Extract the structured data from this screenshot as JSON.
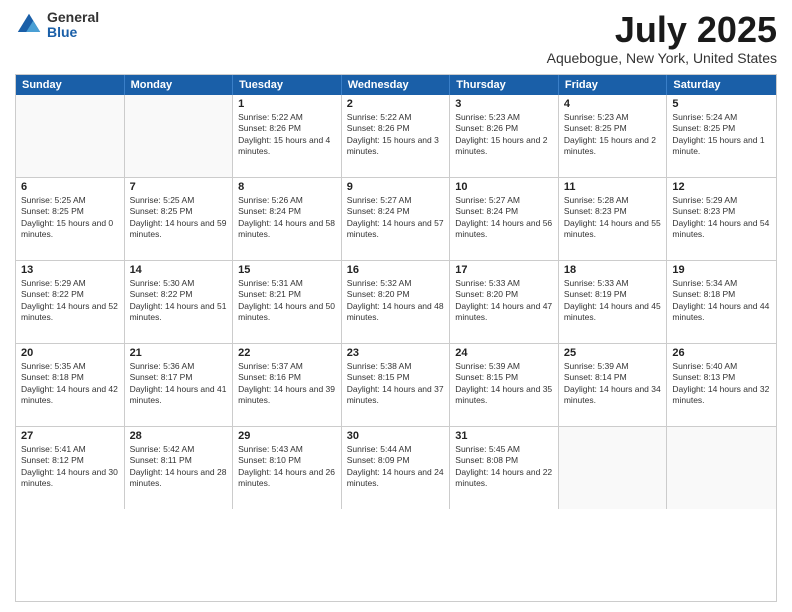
{
  "logo": {
    "general": "General",
    "blue": "Blue"
  },
  "header": {
    "title": "July 2025",
    "subtitle": "Aquebogue, New York, United States"
  },
  "days_of_week": [
    "Sunday",
    "Monday",
    "Tuesday",
    "Wednesday",
    "Thursday",
    "Friday",
    "Saturday"
  ],
  "weeks": [
    [
      {
        "day": "",
        "empty": true
      },
      {
        "day": "",
        "empty": true
      },
      {
        "day": "1",
        "sunrise": "Sunrise: 5:22 AM",
        "sunset": "Sunset: 8:26 PM",
        "daylight": "Daylight: 15 hours and 4 minutes."
      },
      {
        "day": "2",
        "sunrise": "Sunrise: 5:22 AM",
        "sunset": "Sunset: 8:26 PM",
        "daylight": "Daylight: 15 hours and 3 minutes."
      },
      {
        "day": "3",
        "sunrise": "Sunrise: 5:23 AM",
        "sunset": "Sunset: 8:26 PM",
        "daylight": "Daylight: 15 hours and 2 minutes."
      },
      {
        "day": "4",
        "sunrise": "Sunrise: 5:23 AM",
        "sunset": "Sunset: 8:25 PM",
        "daylight": "Daylight: 15 hours and 2 minutes."
      },
      {
        "day": "5",
        "sunrise": "Sunrise: 5:24 AM",
        "sunset": "Sunset: 8:25 PM",
        "daylight": "Daylight: 15 hours and 1 minute."
      }
    ],
    [
      {
        "day": "6",
        "sunrise": "Sunrise: 5:25 AM",
        "sunset": "Sunset: 8:25 PM",
        "daylight": "Daylight: 15 hours and 0 minutes."
      },
      {
        "day": "7",
        "sunrise": "Sunrise: 5:25 AM",
        "sunset": "Sunset: 8:25 PM",
        "daylight": "Daylight: 14 hours and 59 minutes."
      },
      {
        "day": "8",
        "sunrise": "Sunrise: 5:26 AM",
        "sunset": "Sunset: 8:24 PM",
        "daylight": "Daylight: 14 hours and 58 minutes."
      },
      {
        "day": "9",
        "sunrise": "Sunrise: 5:27 AM",
        "sunset": "Sunset: 8:24 PM",
        "daylight": "Daylight: 14 hours and 57 minutes."
      },
      {
        "day": "10",
        "sunrise": "Sunrise: 5:27 AM",
        "sunset": "Sunset: 8:24 PM",
        "daylight": "Daylight: 14 hours and 56 minutes."
      },
      {
        "day": "11",
        "sunrise": "Sunrise: 5:28 AM",
        "sunset": "Sunset: 8:23 PM",
        "daylight": "Daylight: 14 hours and 55 minutes."
      },
      {
        "day": "12",
        "sunrise": "Sunrise: 5:29 AM",
        "sunset": "Sunset: 8:23 PM",
        "daylight": "Daylight: 14 hours and 54 minutes."
      }
    ],
    [
      {
        "day": "13",
        "sunrise": "Sunrise: 5:29 AM",
        "sunset": "Sunset: 8:22 PM",
        "daylight": "Daylight: 14 hours and 52 minutes."
      },
      {
        "day": "14",
        "sunrise": "Sunrise: 5:30 AM",
        "sunset": "Sunset: 8:22 PM",
        "daylight": "Daylight: 14 hours and 51 minutes."
      },
      {
        "day": "15",
        "sunrise": "Sunrise: 5:31 AM",
        "sunset": "Sunset: 8:21 PM",
        "daylight": "Daylight: 14 hours and 50 minutes."
      },
      {
        "day": "16",
        "sunrise": "Sunrise: 5:32 AM",
        "sunset": "Sunset: 8:20 PM",
        "daylight": "Daylight: 14 hours and 48 minutes."
      },
      {
        "day": "17",
        "sunrise": "Sunrise: 5:33 AM",
        "sunset": "Sunset: 8:20 PM",
        "daylight": "Daylight: 14 hours and 47 minutes."
      },
      {
        "day": "18",
        "sunrise": "Sunrise: 5:33 AM",
        "sunset": "Sunset: 8:19 PM",
        "daylight": "Daylight: 14 hours and 45 minutes."
      },
      {
        "day": "19",
        "sunrise": "Sunrise: 5:34 AM",
        "sunset": "Sunset: 8:18 PM",
        "daylight": "Daylight: 14 hours and 44 minutes."
      }
    ],
    [
      {
        "day": "20",
        "sunrise": "Sunrise: 5:35 AM",
        "sunset": "Sunset: 8:18 PM",
        "daylight": "Daylight: 14 hours and 42 minutes."
      },
      {
        "day": "21",
        "sunrise": "Sunrise: 5:36 AM",
        "sunset": "Sunset: 8:17 PM",
        "daylight": "Daylight: 14 hours and 41 minutes."
      },
      {
        "day": "22",
        "sunrise": "Sunrise: 5:37 AM",
        "sunset": "Sunset: 8:16 PM",
        "daylight": "Daylight: 14 hours and 39 minutes."
      },
      {
        "day": "23",
        "sunrise": "Sunrise: 5:38 AM",
        "sunset": "Sunset: 8:15 PM",
        "daylight": "Daylight: 14 hours and 37 minutes."
      },
      {
        "day": "24",
        "sunrise": "Sunrise: 5:39 AM",
        "sunset": "Sunset: 8:15 PM",
        "daylight": "Daylight: 14 hours and 35 minutes."
      },
      {
        "day": "25",
        "sunrise": "Sunrise: 5:39 AM",
        "sunset": "Sunset: 8:14 PM",
        "daylight": "Daylight: 14 hours and 34 minutes."
      },
      {
        "day": "26",
        "sunrise": "Sunrise: 5:40 AM",
        "sunset": "Sunset: 8:13 PM",
        "daylight": "Daylight: 14 hours and 32 minutes."
      }
    ],
    [
      {
        "day": "27",
        "sunrise": "Sunrise: 5:41 AM",
        "sunset": "Sunset: 8:12 PM",
        "daylight": "Daylight: 14 hours and 30 minutes."
      },
      {
        "day": "28",
        "sunrise": "Sunrise: 5:42 AM",
        "sunset": "Sunset: 8:11 PM",
        "daylight": "Daylight: 14 hours and 28 minutes."
      },
      {
        "day": "29",
        "sunrise": "Sunrise: 5:43 AM",
        "sunset": "Sunset: 8:10 PM",
        "daylight": "Daylight: 14 hours and 26 minutes."
      },
      {
        "day": "30",
        "sunrise": "Sunrise: 5:44 AM",
        "sunset": "Sunset: 8:09 PM",
        "daylight": "Daylight: 14 hours and 24 minutes."
      },
      {
        "day": "31",
        "sunrise": "Sunrise: 5:45 AM",
        "sunset": "Sunset: 8:08 PM",
        "daylight": "Daylight: 14 hours and 22 minutes."
      },
      {
        "day": "",
        "empty": true
      },
      {
        "day": "",
        "empty": true
      }
    ]
  ]
}
